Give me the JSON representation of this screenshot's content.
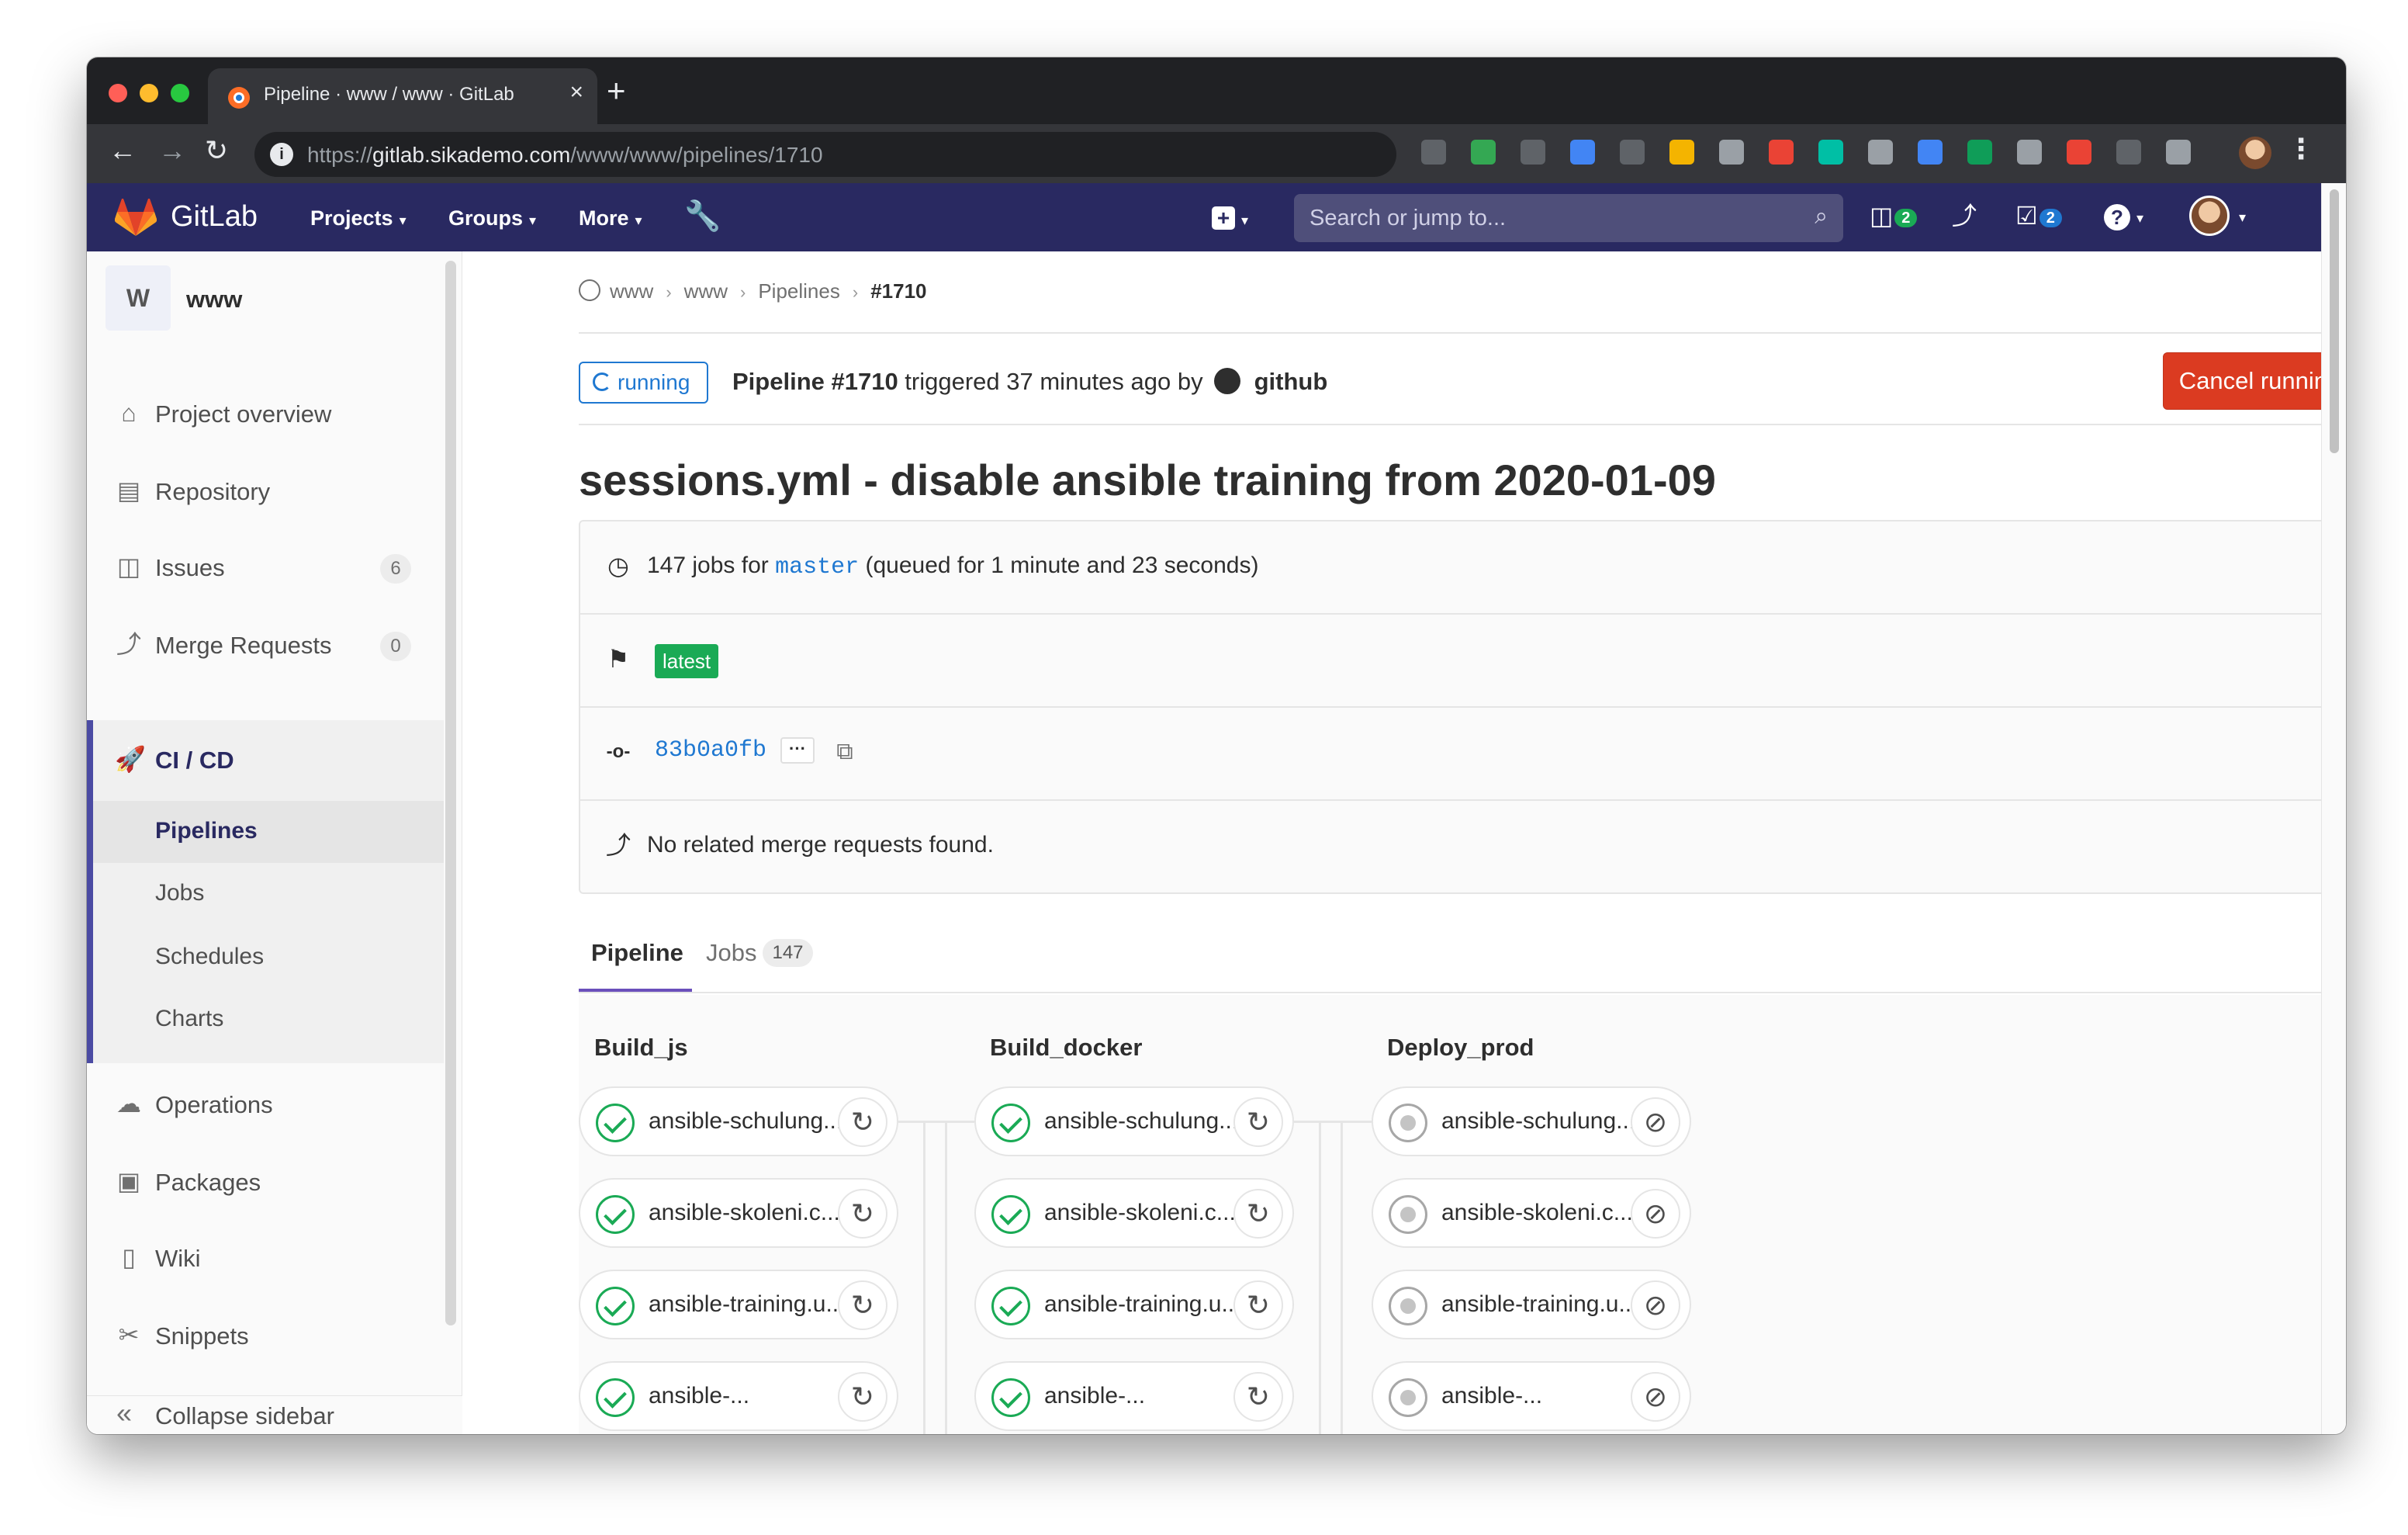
{
  "browser": {
    "tab_title": "Pipeline · www / www · GitLab",
    "tab_close": "×",
    "new_tab": "+",
    "url_prefix": "https://",
    "url_host": "gitlab.sikademo.com",
    "url_path": "/www/www/pipelines/1710",
    "back": "←",
    "forward": "→",
    "reload": "↻",
    "menu": "⋮",
    "extension_colors": [
      "#5f6368",
      "#34a853",
      "#5f6368",
      "#4285f4",
      "#5f6368",
      "#f4b400",
      "#9aa0a6",
      "#ea4335",
      "#00bfa5",
      "#9aa0a6",
      "#4285f4",
      "#0f9d58",
      "#9aa0a6",
      "#ea4335",
      "#5f6368",
      "#9aa0a6"
    ]
  },
  "header": {
    "brand": "GitLab",
    "menus": [
      {
        "label": "Projects",
        "caret": "▾"
      },
      {
        "label": "Groups",
        "caret": "▾"
      },
      {
        "label": "More",
        "caret": "▾"
      }
    ],
    "admin_icon": "🔧",
    "new_plus": "+",
    "new_caret": "▾",
    "search_placeholder": "Search or jump to...",
    "search_icon": "⌕",
    "issues_count": "2",
    "todos_count": "2",
    "help_icon": "?",
    "help_caret": "▾",
    "user_caret": "▾",
    "brand_color": "#292961"
  },
  "sidebar": {
    "project_letter": "W",
    "project_name": "www",
    "items": [
      {
        "icon": "⌂",
        "label": "Project overview"
      },
      {
        "icon": "▤",
        "label": "Repository"
      },
      {
        "icon": "◫",
        "label": "Issues",
        "count": "6"
      },
      {
        "icon": "⤴",
        "label": "Merge Requests",
        "count": "0"
      },
      {
        "icon": "🚀",
        "label": "CI / CD"
      },
      {
        "icon": "☁",
        "label": "Operations"
      },
      {
        "icon": "▣",
        "label": "Packages"
      },
      {
        "icon": "▯",
        "label": "Wiki"
      },
      {
        "icon": "✂",
        "label": "Snippets"
      }
    ],
    "ci_sub": [
      "Pipelines",
      "Jobs",
      "Schedules",
      "Charts"
    ],
    "collapse_icon": "«",
    "collapse_label": "Collapse sidebar"
  },
  "breadcrumb": {
    "items": [
      "www",
      "www",
      "Pipelines"
    ],
    "current": "#1710",
    "separator": "›"
  },
  "pipeline": {
    "status": "running",
    "title_bold": "Pipeline #1710",
    "triggered_text": " triggered 37 minutes ago by",
    "author": "github",
    "cancel_label": "Cancel running",
    "commit_title": "sessions.yml - disable ansible training from 2020-01-09",
    "jobs_text_pre": "147 jobs for ",
    "branch": "master",
    "jobs_text_post": " (queued for 1 minute and 23 seconds)",
    "latest_label": "latest",
    "sha": "83b0a0fb",
    "ellipsis": "···",
    "copy_icon": "⧉",
    "no_mr_text": "No related merge requests found.",
    "row_icons": {
      "clock": "◷",
      "flag": "⚑",
      "commit": "-o-",
      "mr": "⤴"
    }
  },
  "tabs": {
    "pipeline_label": "Pipeline",
    "jobs_label": "Jobs",
    "jobs_count": "147"
  },
  "stages": [
    {
      "name": "Build_js",
      "status": "success",
      "action_icon": "↻",
      "jobs": [
        "ansible-schulung...",
        "ansible-skoleni.c...",
        "ansible-training.u...",
        "ansible-..."
      ]
    },
    {
      "name": "Build_docker",
      "status": "success",
      "action_icon": "↻",
      "jobs": [
        "ansible-schulung...",
        "ansible-skoleni.c...",
        "ansible-training.u...",
        "ansible-..."
      ]
    },
    {
      "name": "Deploy_prod",
      "status": "created",
      "action_icon": "⊘",
      "jobs": [
        "ansible-schulung...",
        "ansible-skoleni.c...",
        "ansible-training.u...",
        "ansible-..."
      ]
    }
  ]
}
